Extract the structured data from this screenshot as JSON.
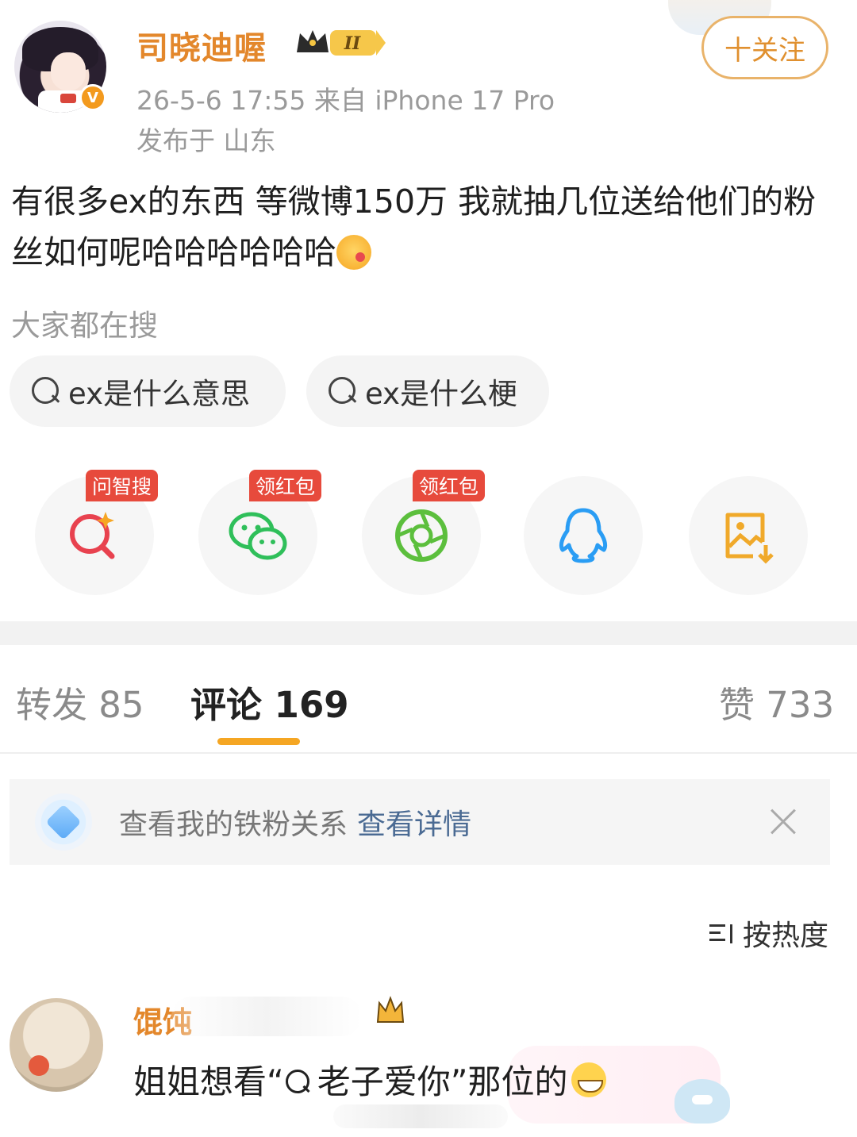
{
  "post": {
    "author": "司晓迪喔",
    "level_badge": "II",
    "verified_mark": "V",
    "time_device": "26-5-6 17:55  来自 iPhone 17 Pro",
    "location": "发布于 山东",
    "follow_label": "十关注",
    "text": "有很多ex的东西 等微博150万 我就抽几位送给他们的粉丝如何呢哈哈哈哈哈哈"
  },
  "search": {
    "heading": "大家都在搜",
    "chips": [
      "ex是什么意思",
      "ex是什么梗"
    ]
  },
  "share": {
    "items": [
      {
        "icon": "ai-search-icon",
        "tag": "问智搜",
        "color": "#e8424f"
      },
      {
        "icon": "wechat-icon",
        "tag": "领红包",
        "color": "#2fbf5a"
      },
      {
        "icon": "moments-icon",
        "tag": "领红包",
        "color": "#5cbf3d"
      },
      {
        "icon": "qq-icon",
        "tag": "",
        "color": "#2a9df4"
      },
      {
        "icon": "save-image-icon",
        "tag": "",
        "color": "#f0a92a"
      }
    ]
  },
  "tabs": {
    "repost": "转发 85",
    "comment": "评论 169",
    "like": "赞 733"
  },
  "fan_bar": {
    "text": "查看我的铁粉关系",
    "link": "查看详情"
  },
  "sort": {
    "label": "按热度"
  },
  "comment": {
    "name_visible": "馄饨",
    "text_before": "姐姐想看“",
    "search_term": "老子爱你 ",
    "text_after": "”那位的"
  },
  "colors": {
    "accent_orange": "#e3872b",
    "tab_underline": "#f5a623",
    "link_blue": "#4a6a93"
  }
}
